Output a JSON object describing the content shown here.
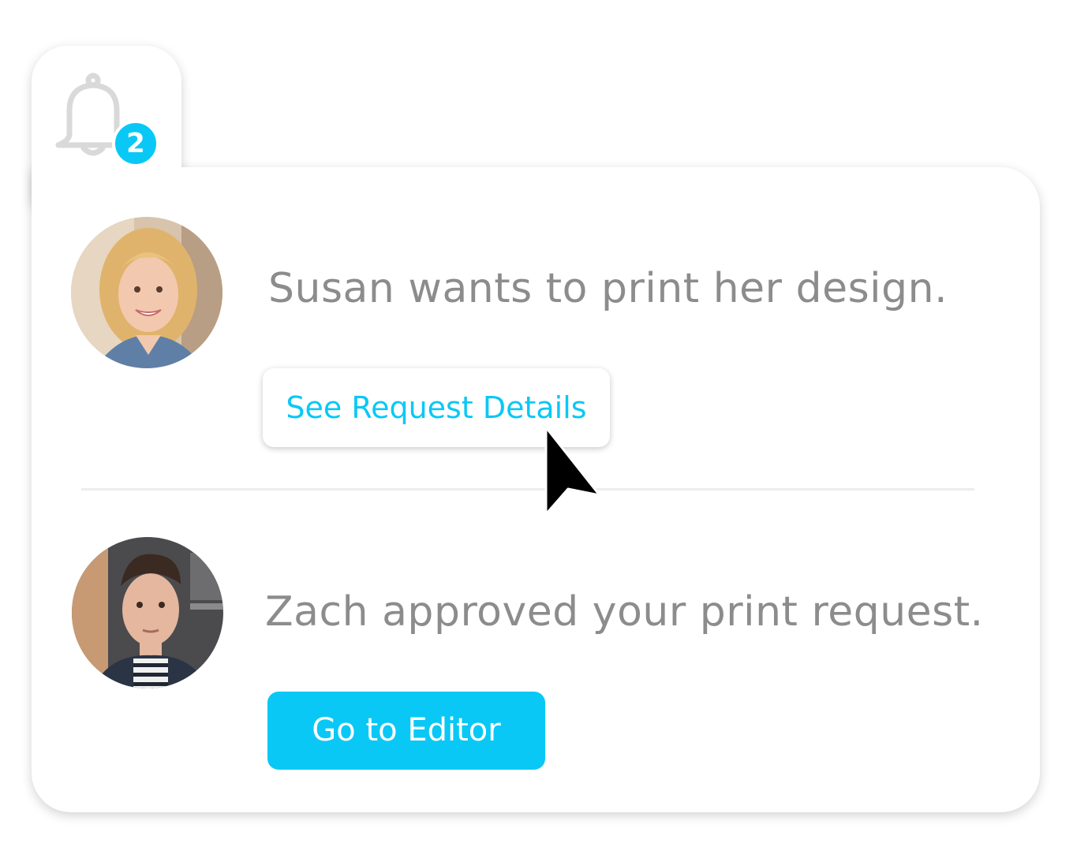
{
  "notifications": {
    "badge_count": "2",
    "bell_icon": "bell-icon",
    "items": [
      {
        "avatar": "user-photo-susan",
        "message": "Susan wants to print her design.",
        "action_label": "See Request Details"
      },
      {
        "avatar": "user-photo-zach",
        "message": "Zach approved your print request.",
        "action_label": "Go to Editor"
      }
    ]
  },
  "colors": {
    "accent": "#0ac8f5",
    "message_text": "#8c8c8c",
    "bell": "#d9d9d9",
    "divider": "#ececec"
  },
  "cursor_icon": "mouse-pointer-icon"
}
